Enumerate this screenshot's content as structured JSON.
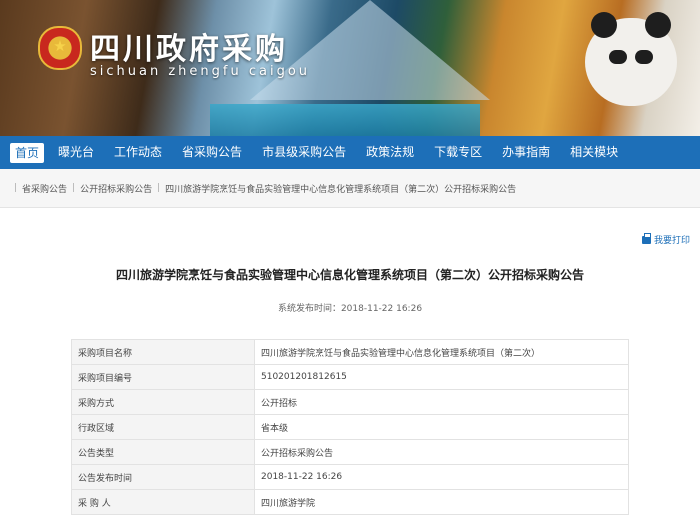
{
  "header": {
    "site_title": "四川政府采购",
    "site_subtitle": "sichuan  zhengfu  caigou",
    "emblem_icon": "national-emblem-icon"
  },
  "nav": {
    "items": [
      "首页",
      "曝光台",
      "工作动态",
      "省采购公告",
      "市县级采购公告",
      "政策法规",
      "下载专区",
      "办事指南",
      "相关模块"
    ],
    "active_index": 0
  },
  "breadcrumb": {
    "items": [
      "省采购公告",
      "公开招标采购公告",
      "四川旅游学院烹饪与食品实验管理中心信息化管理系统项目（第二次）公开招标采购公告"
    ],
    "separator": "|"
  },
  "print_label": "我要打印",
  "article": {
    "title": "四川旅游学院烹饪与食品实验管理中心信息化管理系统项目（第二次）公开招标采购公告",
    "publish_time": "系统发布时间：2018-11-22 16:26"
  },
  "info_table": [
    {
      "key": "采购项目名称",
      "value": "四川旅游学院烹饪与食品实验管理中心信息化管理系统项目（第二次）"
    },
    {
      "key": "采购项目编号",
      "value": "510201201812615"
    },
    {
      "key": "采购方式",
      "value": "公开招标"
    },
    {
      "key": "行政区域",
      "value": "省本级"
    },
    {
      "key": "公告类型",
      "value": "公开招标采购公告"
    },
    {
      "key": "公告发布时间",
      "value": "2018-11-22 16:26"
    },
    {
      "key": "采 购 人",
      "value": "四川旅游学院"
    }
  ],
  "colors": {
    "nav_bg": "#1d6fb8",
    "accent": "#1d6fb8"
  }
}
